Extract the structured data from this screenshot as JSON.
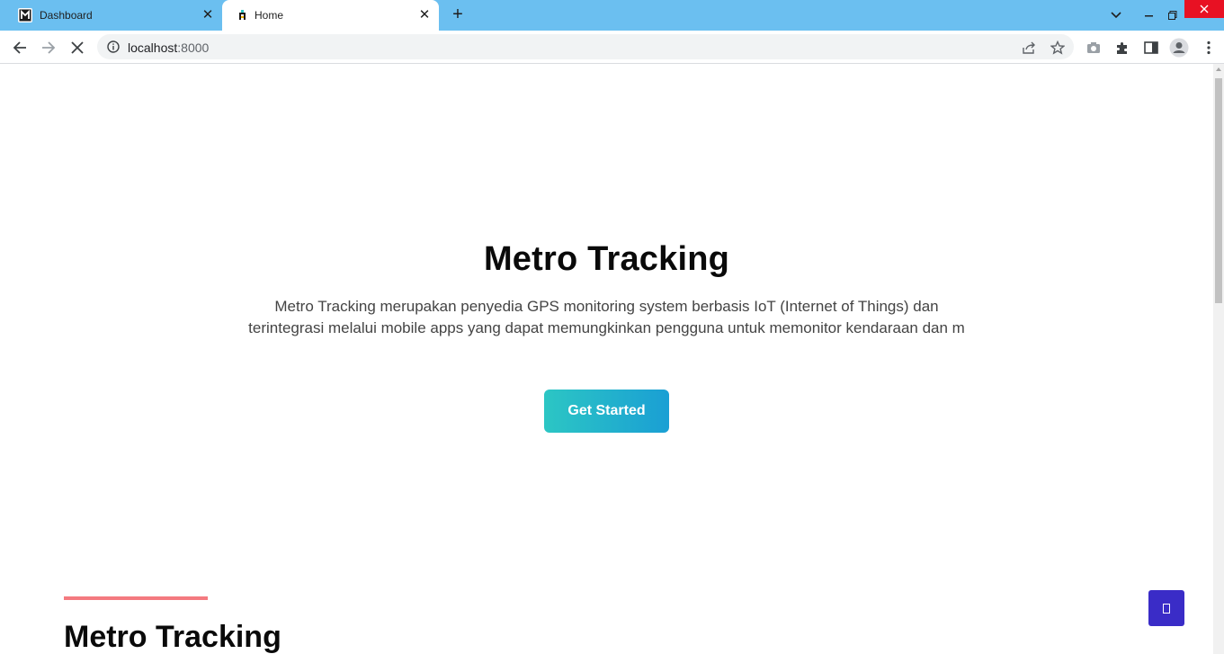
{
  "browser": {
    "tabs": [
      {
        "label": "Dashboard",
        "active": false
      },
      {
        "label": "Home",
        "active": true
      }
    ],
    "new_tab_symbol": "+",
    "close_symbol": "✕",
    "url_host": "localhost",
    "url_port": ":8000"
  },
  "hero": {
    "title": "Metro Tracking",
    "description": "Metro Tracking merupakan penyedia GPS monitoring system berbasis IoT (Internet of Things) dan terintegrasi melalui mobile apps yang dapat memungkinkan pengguna untuk memonitor kendaraan dan m",
    "cta_label": "Get Started"
  },
  "section": {
    "title": "Metro Tracking"
  },
  "colors": {
    "tab_strip": "#6bbff0",
    "cta_gradient_start": "#2cc6c4",
    "cta_gradient_end": "#1a9fd4",
    "section_accent": "#f47a80",
    "floating_button": "#3a2cc7"
  },
  "icons": {
    "tab_favicon_dashboard": "metro-logo-icon",
    "tab_favicon_home": "metro-small-icon",
    "back": "arrow-left-icon",
    "forward": "arrow-right-icon",
    "reload": "stop-loading-icon",
    "site_info": "info-icon",
    "share": "share-icon",
    "bookmark": "star-icon",
    "camera": "camera-icon",
    "extensions": "puzzle-icon",
    "side_panel": "side-panel-icon",
    "profile": "profile-icon",
    "menu": "kebab-menu-icon",
    "floating": "square-icon"
  }
}
